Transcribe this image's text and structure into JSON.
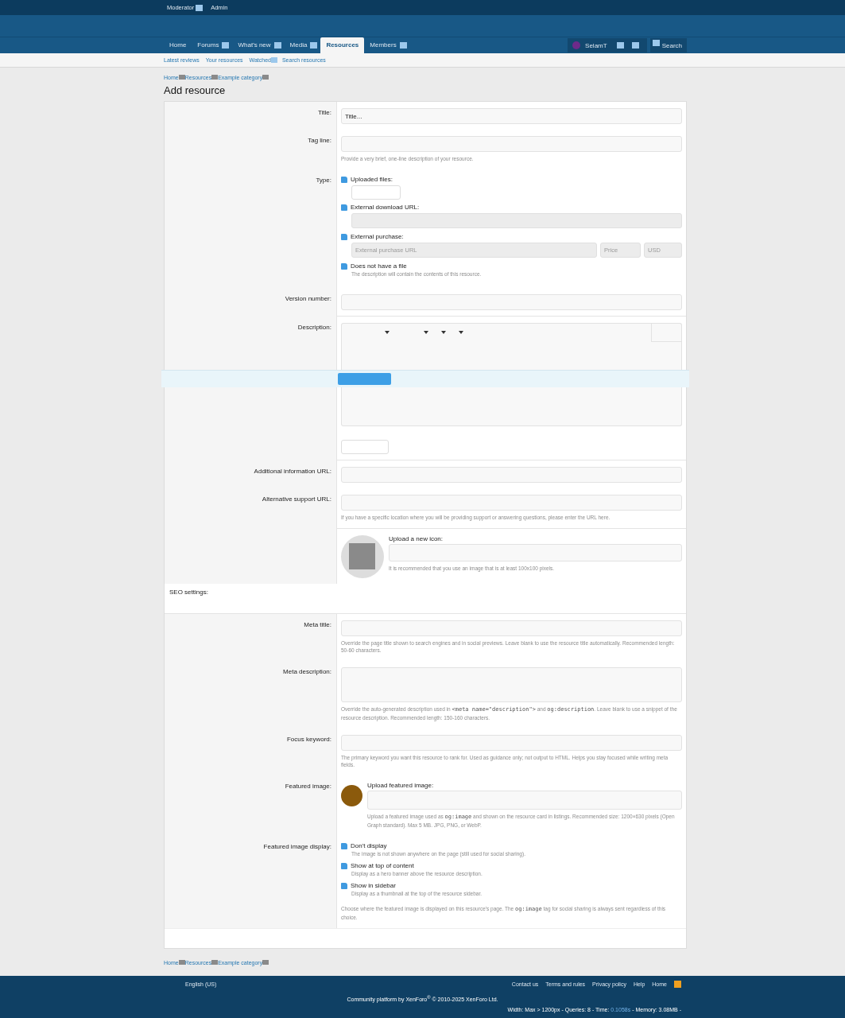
{
  "top_bar": {
    "links": [
      "Moderator",
      "Admin"
    ]
  },
  "nav": {
    "tabs": [
      {
        "label": "Home",
        "selected": false,
        "menu": false
      },
      {
        "label": "Forums",
        "selected": false,
        "menu": true
      },
      {
        "label": "What's new",
        "selected": false,
        "menu": true
      },
      {
        "label": "Media",
        "selected": false,
        "menu": true
      },
      {
        "label": "Resources",
        "selected": true,
        "menu": false
      },
      {
        "label": "Members",
        "selected": false,
        "menu": true
      }
    ],
    "user": "SelamT",
    "search": "Search"
  },
  "sub_nav": [
    {
      "label": "Latest reviews",
      "menu": false
    },
    {
      "label": "Your resources",
      "menu": false
    },
    {
      "label": "Watched",
      "menu": true
    },
    {
      "label": "Search resources",
      "menu": false
    }
  ],
  "breadcrumb": [
    "Home",
    "Resources",
    "Example category"
  ],
  "breadcrumb_bottom": [
    "Home",
    "Resources",
    "Example category"
  ],
  "page_title": "Add resource",
  "form": [
    {
      "kind": "text",
      "label": "Title:",
      "value": "Title..."
    },
    {
      "kind": "text",
      "label": "Tag line:",
      "hint": [
        {
          "text": "Provide a very brief, one-line description of your resource.",
          "kind": "plain"
        }
      ]
    },
    {
      "kind": "radio",
      "label": "Type:",
      "options": [
        {
          "label": "Uploaded files:",
          "kind": "upload",
          "selected": false
        },
        {
          "label": "External download URL:",
          "kind": "url",
          "selected": false
        },
        {
          "label": "External purchase:",
          "kind": "purchase",
          "selected": false,
          "placeholders": [
            "External purchase URL",
            "Price",
            "USD"
          ]
        },
        {
          "label": "Does not have a file",
          "kind": "plain",
          "selected": false,
          "note": "The description will contain the contents of this resource."
        }
      ]
    },
    {
      "kind": "text",
      "label": "Version number:",
      "divider": true
    },
    {
      "kind": "editor",
      "label": "Description:",
      "divider": true
    },
    {
      "kind": "text",
      "label": "Additional information URL:"
    },
    {
      "kind": "text",
      "label": "Alternative support URL:",
      "hint": [
        {
          "text": "If you have a specific location where you will be providing support or answering questions, please enter the URL here.",
          "kind": "plain"
        }
      ],
      "divider": true
    },
    {
      "kind": "icon_upload",
      "title": "Upload a new icon:",
      "hint": "It is recommended that you use an image that is at least 100x100 pixels."
    },
    {
      "kind": "section",
      "label": "SEO settings:"
    },
    {
      "kind": "text",
      "label": "Meta title:",
      "hint": [
        {
          "text": "Override the page title shown to search engines and in social previews. Leave blank to use the resource title automatically. Recommended length: 50-60 characters.",
          "kind": "plain"
        }
      ]
    },
    {
      "kind": "textarea",
      "label": "Meta description:",
      "hint": [
        {
          "text": "Override the auto-generated description used in ",
          "kind": "plain"
        },
        {
          "text": "<meta name=\"description\">",
          "kind": "code"
        },
        {
          "text": " and ",
          "kind": "plain"
        },
        {
          "text": "og:description",
          "kind": "code"
        },
        {
          "text": ". Leave blank to use a snippet of the resource description. Recommended length: 150-160 characters.",
          "kind": "plain"
        }
      ]
    },
    {
      "kind": "text",
      "label": "Focus keyword:",
      "hint": [
        {
          "text": "The primary keyword you want this resource to rank for. Used as guidance only; not output to HTML. Helps you stay focused while writing meta fields.",
          "kind": "plain"
        }
      ]
    },
    {
      "kind": "featured",
      "label": "Featured image:",
      "title": "Upload featured image:",
      "color": "#8b5a0c",
      "hint": [
        {
          "text": "Upload a featured image used as ",
          "kind": "plain"
        },
        {
          "text": "og:image",
          "kind": "code"
        },
        {
          "text": " and shown on the resource card in listings. Recommended size: 1200×630 pixels (Open Graph standard). Max 5 MB. JPG, PNG, or WebP.",
          "kind": "plain"
        }
      ]
    },
    {
      "kind": "radio",
      "label": "Featured image display:",
      "options": [
        {
          "label": "Don't display",
          "kind": "plain",
          "selected": false,
          "note": "The image is not shown anywhere on the page (still used for social sharing)."
        },
        {
          "label": "Show at top of content",
          "kind": "plain",
          "selected": false,
          "note": "Display as a hero banner above the resource description."
        },
        {
          "label": "Show in sidebar",
          "kind": "plain",
          "selected": false,
          "note": "Display as a thumbnail at the top of the resource sidebar."
        }
      ],
      "hint": [
        {
          "text": "Choose where the featured image is displayed on this resource's page. The ",
          "kind": "plain"
        },
        {
          "text": "og:image",
          "kind": "code"
        },
        {
          "text": " tag for social sharing is always sent regardless of this choice.",
          "kind": "plain"
        }
      ]
    }
  ],
  "footer": {
    "language": "English (US)",
    "links": [
      "Contact us",
      "Terms and rules",
      "Privacy policy",
      "Help",
      "Home"
    ],
    "copyright": "Community platform by XenForo$^{®}$ © 2010-2025 XenForo Ltd.",
    "stats": [
      {
        "text": "Width: Max > 1200px - Queries: 8 - Time: ",
        "kind": "plain"
      },
      {
        "text": "0.1058s",
        "kind": "link"
      },
      {
        "text": " - Memory: 3.08MB -",
        "kind": "plain"
      }
    ]
  }
}
